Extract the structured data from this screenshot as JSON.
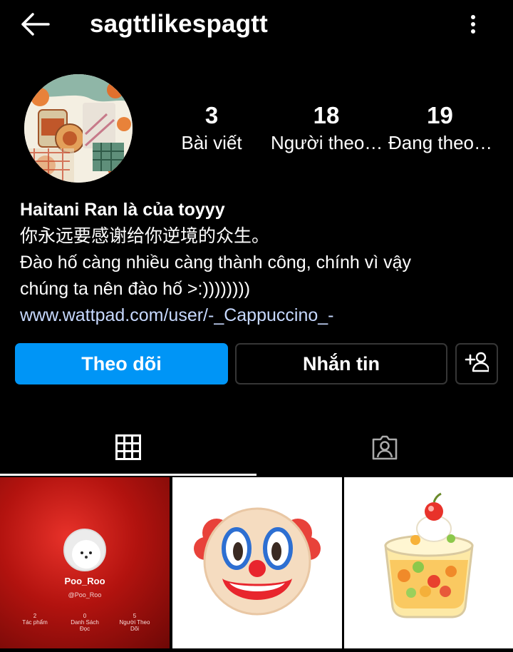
{
  "header": {
    "username": "sagttlikespagtt",
    "back_icon": "arrow-left-icon",
    "menu_icon": "more-vertical-icon"
  },
  "stats": {
    "posts_count": "3",
    "posts_label": "Bài viết",
    "followers_count": "18",
    "followers_label": "Người theo…",
    "following_count": "19",
    "following_label": "Đang theo…"
  },
  "bio": {
    "name": "Haitani Ran là của toyyy",
    "line1": "你永远要感谢给你逆境的众生。",
    "line2": "Đào hố càng nhiều càng thành công, chính vì vậy",
    "line3": "chúng ta nên đào hố >:))))))))",
    "link": "www.wattpad.com/user/-_Cappuccino_-"
  },
  "actions": {
    "follow_label": "Theo dõi",
    "message_label": "Nhắn tin",
    "suggest_icon": "add-user-icon",
    "follow_color": "#0095f6"
  },
  "tabs": {
    "grid_icon": "grid-icon",
    "tagged_icon": "tagged-person-icon"
  },
  "posts": {
    "post1": {
      "name": "Poo_Roo",
      "handle": "@Poo_Roo",
      "stat1_value": "2",
      "stat1_label": "Tác phẩm",
      "stat2_value": "0",
      "stat2_label1": "Danh Sách",
      "stat2_label2": "Đọc",
      "stat3_value": "5",
      "stat3_label1": "Người Theo",
      "stat3_label2": "Dõi"
    },
    "post2_icon": "clown-face-icon",
    "post3_icon": "jelly-cup-icon"
  }
}
